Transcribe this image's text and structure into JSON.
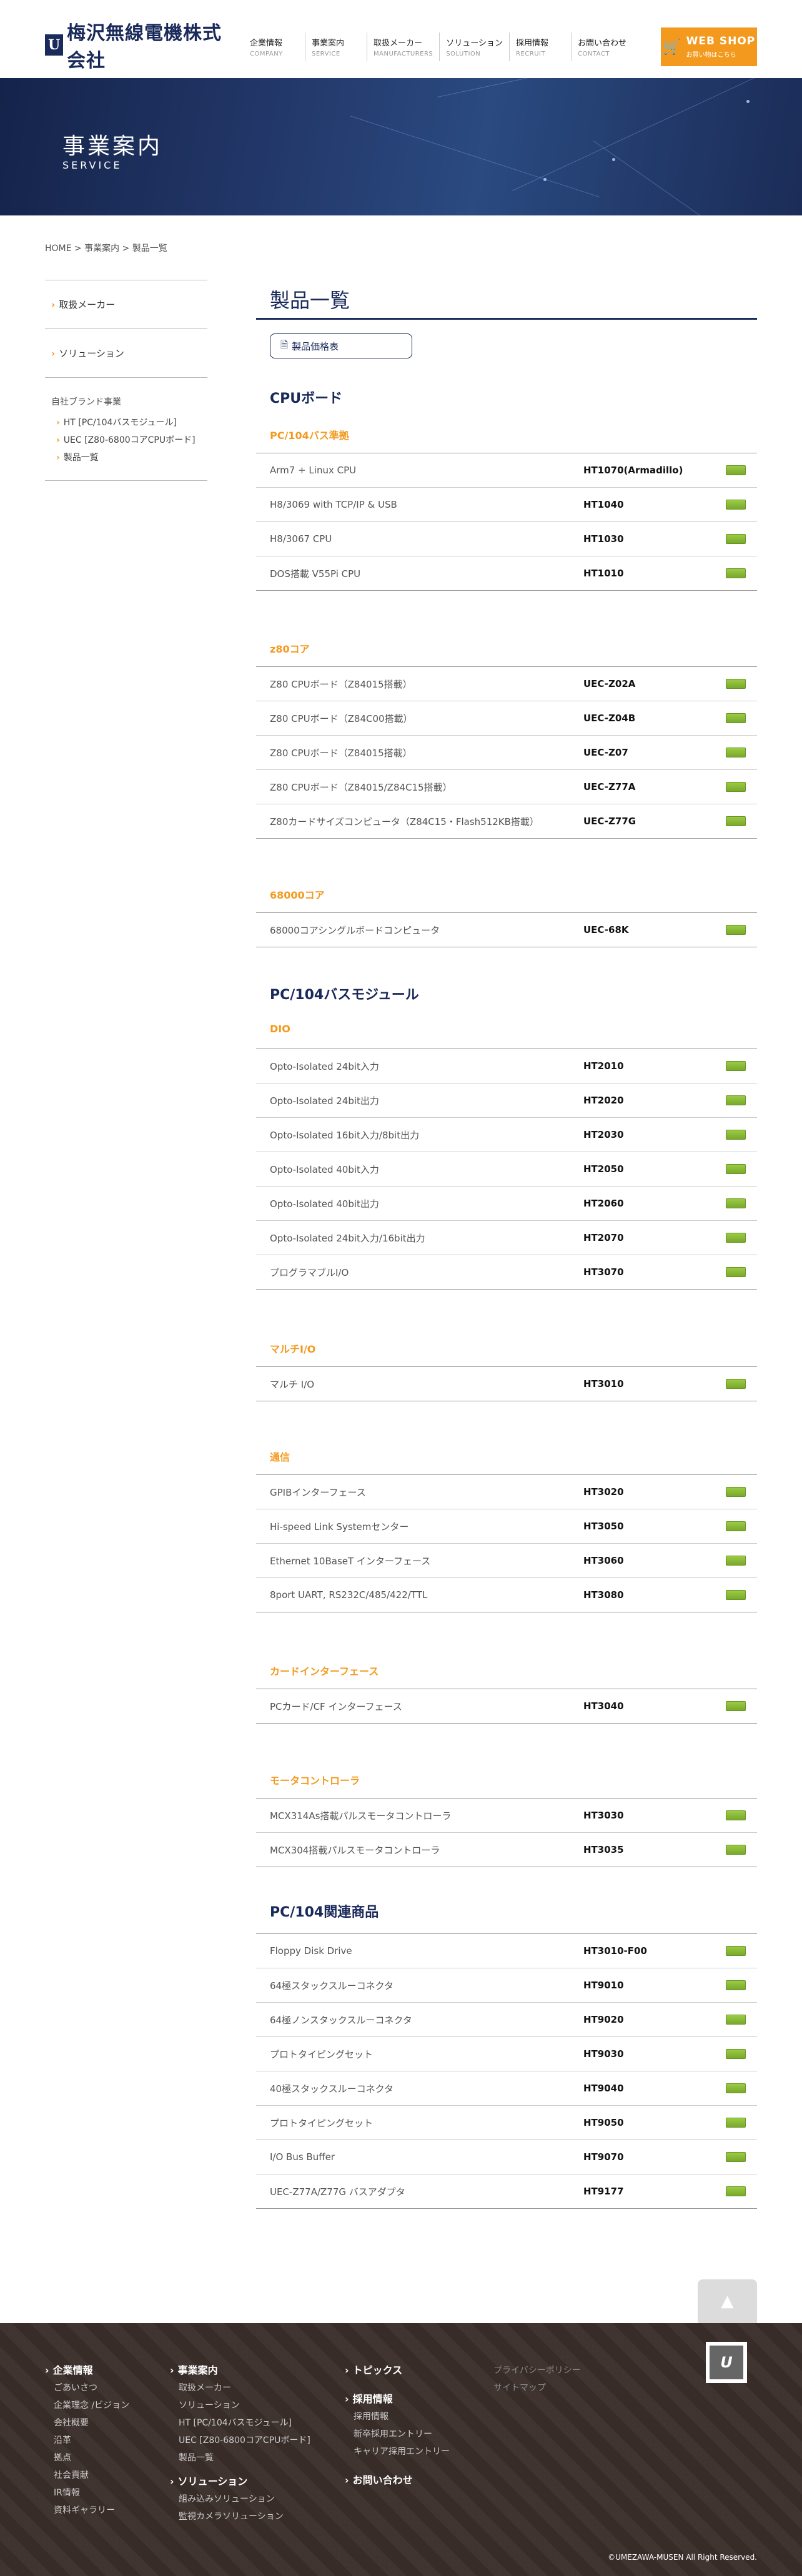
{
  "header": {
    "logo_mark": "U",
    "logo_text": "梅沢無線電機株式会社",
    "nav": [
      {
        "ja": "企業情報",
        "en": "COMPANY"
      },
      {
        "ja": "事業案内",
        "en": "SERVICE"
      },
      {
        "ja": "取扱メーカー",
        "en": "MANUFACTURERS"
      },
      {
        "ja": "ソリューション",
        "en": "SOLUTION"
      },
      {
        "ja": "採用情報",
        "en": "RECRUIT"
      },
      {
        "ja": "お問い合わせ",
        "en": "CONTACT"
      }
    ],
    "webshop_title": "WEB SHOP",
    "webshop_sub": "お買い物はこちら"
  },
  "hero": {
    "title_ja": "事業案内",
    "title_en": "SERVICE"
  },
  "breadcrumb": "HOME > 事業案内 > 製品一覧",
  "sidebar": {
    "item1": "取扱メーカー",
    "item2": "ソリューション",
    "brand_head": "自社ブランド事業",
    "brand_items": [
      "HT [PC/104バスモジュール]",
      "UEC [Z80-6800コアCPUボード]",
      "製品一覧"
    ]
  },
  "main": {
    "title": "製品一覧",
    "pdf_label": "製品価格表",
    "sections": [
      {
        "title": "CPUボード"
      },
      {
        "title": "PC/104バスモジュール"
      },
      {
        "title": "PC/104関連商品"
      }
    ],
    "groups": [
      {
        "title": "PC/104バス準拠",
        "rows": [
          {
            "name": "Arm7 + Linux CPU",
            "code": "HT1070(Armadillo)"
          },
          {
            "name": "H8/3069 with TCP/IP & USB",
            "code": "HT1040"
          },
          {
            "name": "H8/3067 CPU",
            "code": "HT1030"
          },
          {
            "name": "DOS搭載 V55Pi CPU",
            "code": "HT1010"
          }
        ]
      },
      {
        "title": "z80コア",
        "rows": [
          {
            "name": "Z80 CPUボード（Z84015搭載）",
            "code": "UEC-Z02A"
          },
          {
            "name": "Z80 CPUボード（Z84C00搭載）",
            "code": "UEC-Z04B"
          },
          {
            "name": "Z80 CPUボード（Z84015搭載）",
            "code": "UEC-Z07"
          },
          {
            "name": "Z80 CPUボード（Z84015/Z84C15搭載）",
            "code": "UEC-Z77A"
          },
          {
            "name": "Z80カードサイズコンピュータ（Z84C15・Flash512KB搭載）",
            "code": "UEC-Z77G"
          }
        ]
      },
      {
        "title": "68000コア",
        "rows": [
          {
            "name": "68000コアシングルボードコンピュータ",
            "code": "UEC-68K"
          }
        ]
      },
      {
        "title": "DIO",
        "rows": [
          {
            "name": "Opto-Isolated 24bit入力",
            "code": "HT2010"
          },
          {
            "name": "Opto-Isolated 24bit出力",
            "code": "HT2020"
          },
          {
            "name": "Opto-Isolated 16bit入力/8bit出力",
            "code": "HT2030"
          },
          {
            "name": "Opto-Isolated 40bit入力",
            "code": "HT2050"
          },
          {
            "name": "Opto-Isolated 40bit出力",
            "code": "HT2060"
          },
          {
            "name": "Opto-Isolated 24bit入力/16bit出力",
            "code": "HT2070"
          },
          {
            "name": "プログラマブルI/O",
            "code": "HT3070"
          }
        ]
      },
      {
        "title": "マルチI/O",
        "rows": [
          {
            "name": "マルチ I/O",
            "code": "HT3010"
          }
        ]
      },
      {
        "title": "通信",
        "rows": [
          {
            "name": "GPIBインターフェース",
            "code": "HT3020"
          },
          {
            "name": "Hi-speed Link Systemセンター",
            "code": "HT3050"
          },
          {
            "name": "Ethernet 10BaseT インターフェース",
            "code": "HT3060"
          },
          {
            "name": "8port UART, RS232C/485/422/TTL",
            "code": "HT3080"
          }
        ]
      },
      {
        "title": "カードインターフェース",
        "rows": [
          {
            "name": "PCカード/CF インターフェース",
            "code": "HT3040"
          }
        ]
      },
      {
        "title": "モータコントローラ",
        "rows": [
          {
            "name": "MCX314As搭載パルスモータコントローラ",
            "code": "HT3030"
          },
          {
            "name": "MCX304搭載パルスモータコントローラ",
            "code": "HT3035"
          }
        ]
      },
      {
        "title": "",
        "rows": [
          {
            "name": "Floppy Disk Drive",
            "code": "HT3010-F00"
          },
          {
            "name": "64極スタックスルーコネクタ",
            "code": "HT9010"
          },
          {
            "name": "64極ノンスタックスルーコネクタ",
            "code": "HT9020"
          },
          {
            "name": "プロトタイピングセット",
            "code": "HT9030"
          },
          {
            "name": "40極スタックスルーコネクタ",
            "code": "HT9040"
          },
          {
            "name": "プロトタイピングセット",
            "code": "HT9050"
          },
          {
            "name": "I/O Bus Buffer",
            "code": "HT9070"
          },
          {
            "name": "UEC-Z77A/Z77G バスアダプタ",
            "code": "HT9177"
          }
        ]
      }
    ]
  },
  "footer": {
    "col1_head": "企業情報",
    "col1_items": [
      "ごあいさつ",
      "企業理念 /ビジョン",
      "会社概要",
      "沿革",
      "拠点",
      "社会貢献",
      "IR情報",
      "資料ギャラリー"
    ],
    "col2_head": "事業案内",
    "col2_items": [
      "取扱メーカー",
      "ソリューション",
      "HT [PC/104バスモジュール]",
      "UEC [Z80-6800コアCPUボード]",
      "製品一覧"
    ],
    "col2_head2": "ソリューション",
    "col2_items2": [
      "組み込みソリューション",
      "監視カメラソリューション"
    ],
    "col3_head1": "トピックス",
    "col3_head2": "採用情報",
    "col3_items": [
      "採用情報",
      "新卒採用エントリー",
      "キャリア採用エントリー"
    ],
    "col3_head3": "お問い合わせ",
    "col4_items": [
      "プライバシーポリシー",
      "サイトマップ"
    ],
    "logo_mark": "U",
    "copyright": "©UMEZAWA-MUSEN All Right Reserved."
  },
  "pagetop_icon": "arrow-up-icon",
  "colors": {
    "navy": "#1a2a5a",
    "orange": "#f39a1e",
    "green": "#86b534"
  }
}
